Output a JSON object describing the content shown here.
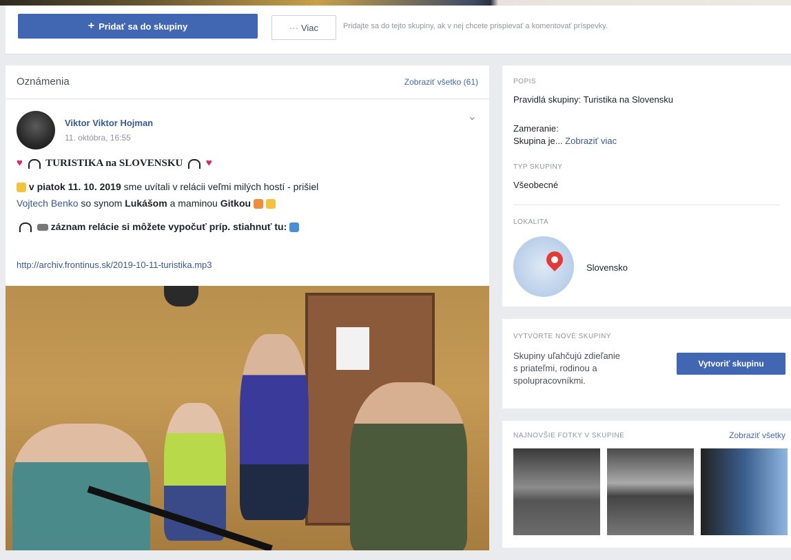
{
  "actions": {
    "join_label": "Pridať sa do skupiny",
    "more_label": "Viac",
    "join_hint": "Pridajte sa do tejto skupiny, ak v nej chcete prispievať a komentovať príspevky."
  },
  "announcements": {
    "title": "Oznámenia",
    "see_all": "Zobraziť všetko (61)"
  },
  "post": {
    "author": "Viktor Viktor Hojman",
    "date": "11. októbra, 16:55",
    "headline": "TURISTIKA na SLOVENSKU",
    "line2_bold": "v piatok 11. 10. 2019",
    "line2_rest": " sme uvítali v relácii veľmi milých hostí - prišiel",
    "line3_link": "Vojtech Benko",
    "line3_a": " so synom ",
    "line3_bold1": "Lukášom",
    "line3_b": " a maminou ",
    "line3_bold2": "Gitkou",
    "line4": "záznam relácie si môžete vypočuť príp. stiahnuť tu:",
    "url": "http://archiv.frontinus.sk/2019-10-11-turistika.mp3"
  },
  "about": {
    "popis_label": "POPIS",
    "popis_text": "Pravidlá skupiny: Turistika na Slovensku",
    "zameranie": "Zameranie:",
    "skupina_je": "Skupina je...",
    "zobrazit_viac": "Zobraziť viac",
    "typ_label": "TYP SKUPINY",
    "typ_value": "Všeobecné",
    "lokalita_label": "LOKALITA",
    "lokalita_value": "Slovensko"
  },
  "create": {
    "label": "VYTVORTE NOVÉ SKUPINY",
    "text_line1": "Skupiny uľahčujú zdieľanie",
    "text_line2": "s priateľmi, rodinou a",
    "text_line3": "spolupracovníkmi.",
    "button": "Vytvoriť skupinu"
  },
  "photos": {
    "label": "NAJNOVŠIE FOTKY V SKUPINE",
    "see_all": "Zobraziť všetky"
  }
}
